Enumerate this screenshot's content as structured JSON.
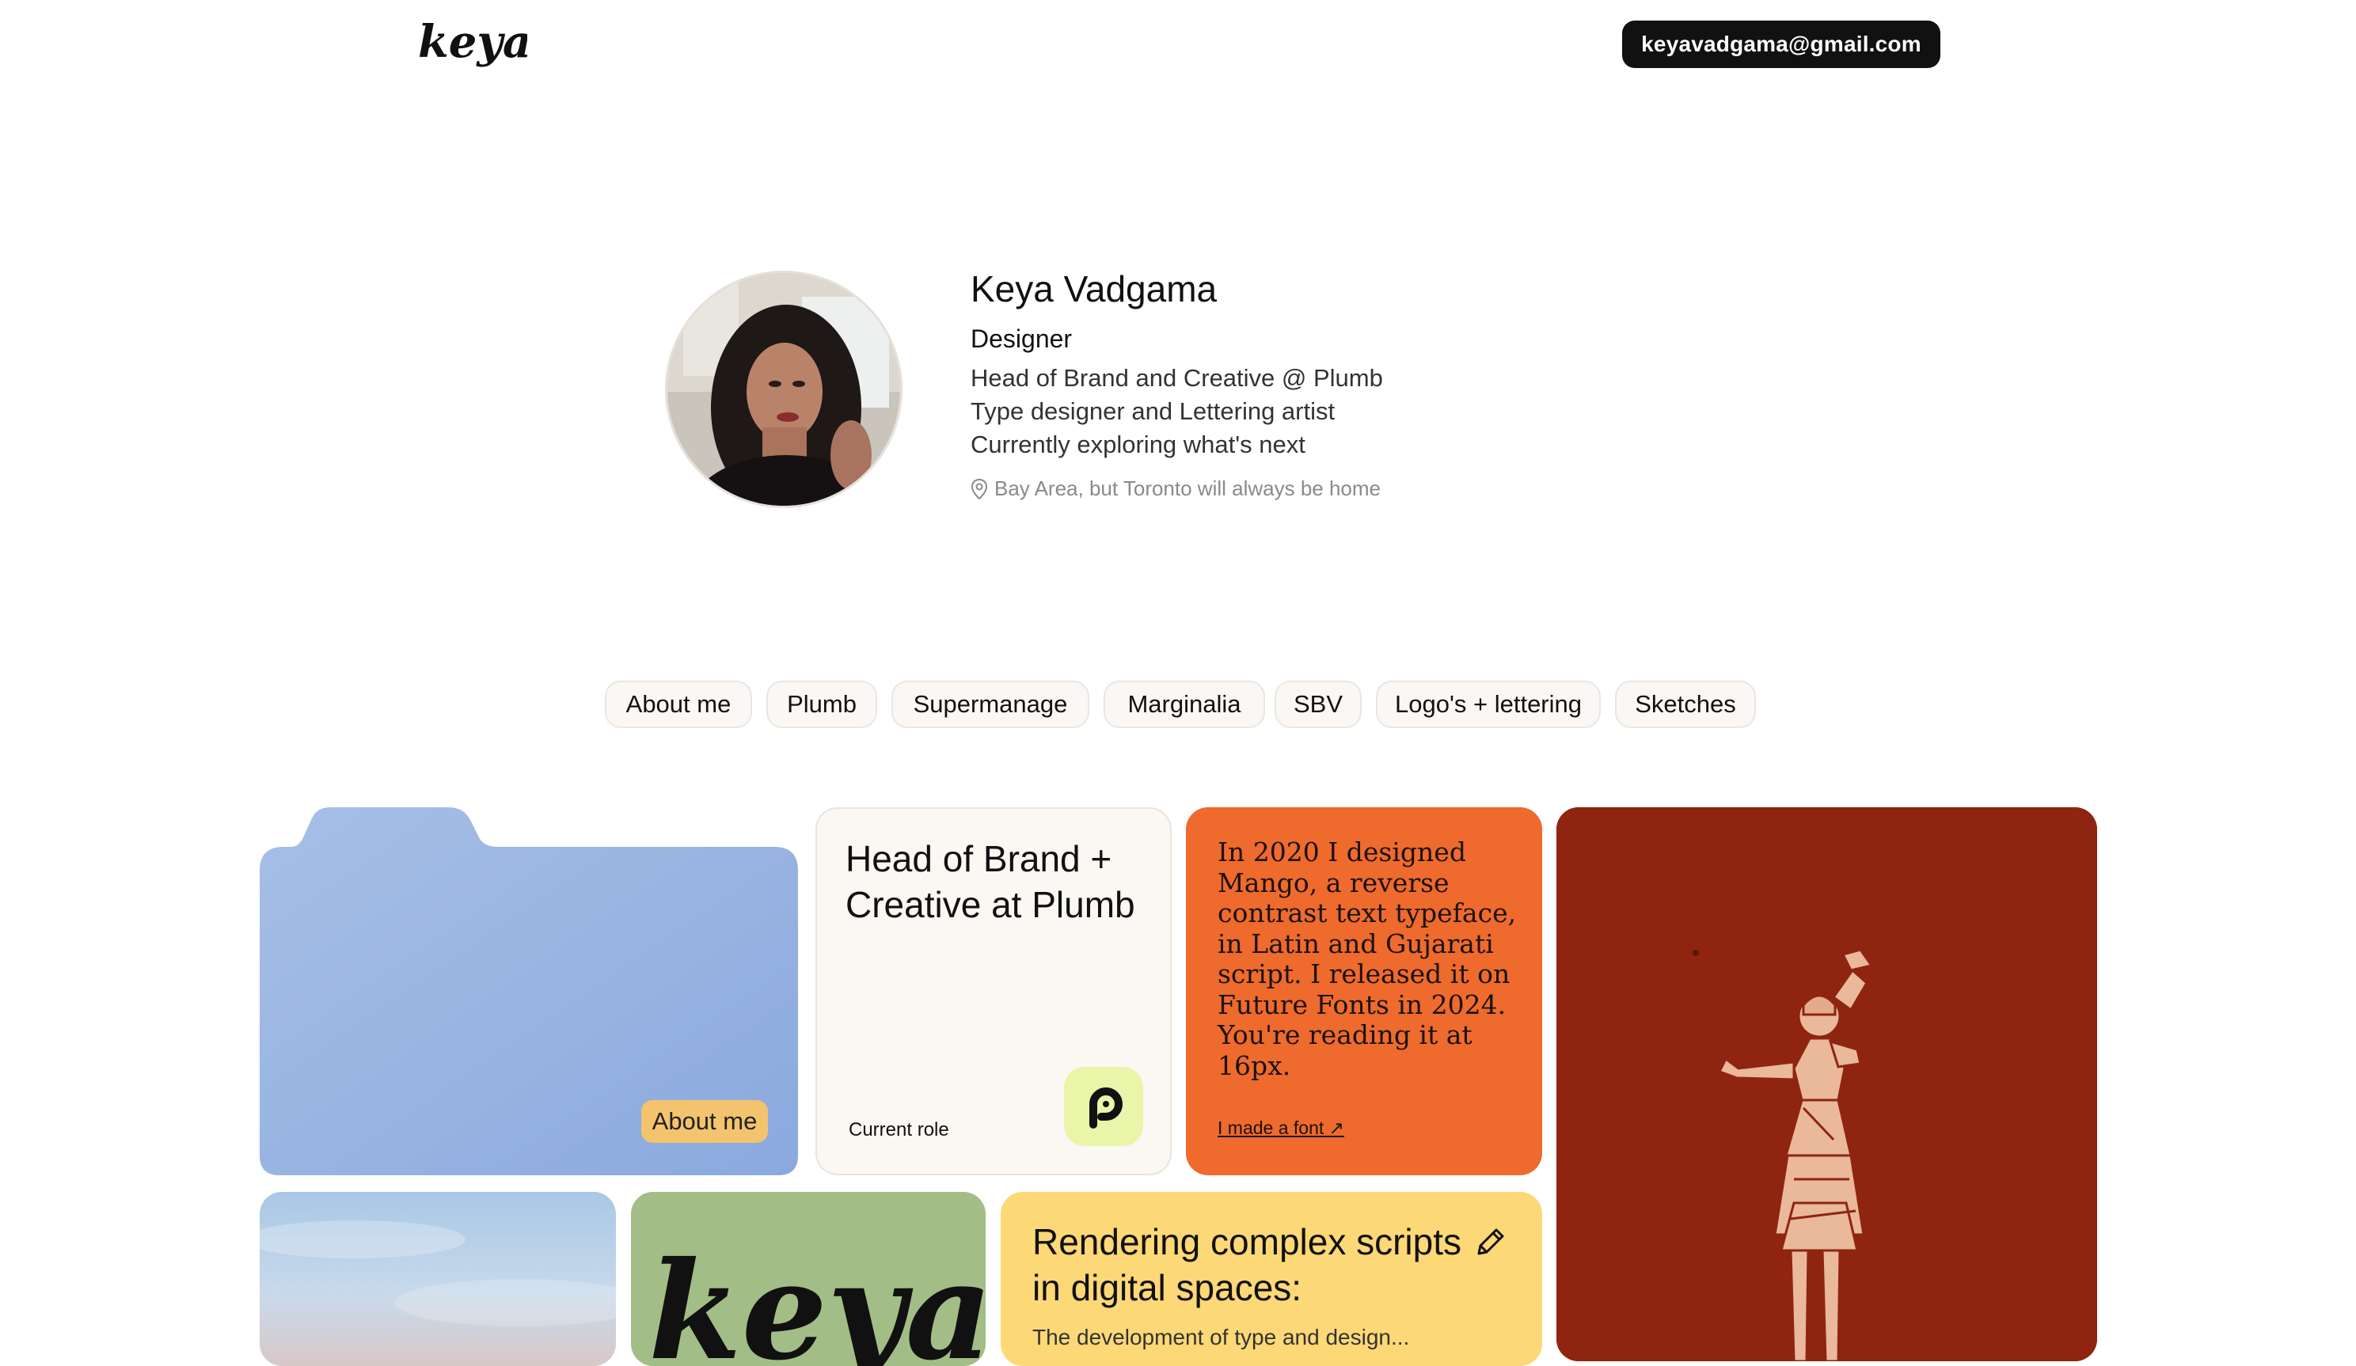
{
  "header": {
    "logo_text": "keya",
    "email": "keyavadgama@gmail.com"
  },
  "profile": {
    "name": "Keya Vadgama",
    "role": "Designer",
    "lines": [
      "Head of Brand and Creative @ Plumb",
      "Type designer and Lettering artist",
      "Currently exploring what's next"
    ],
    "location": "Bay Area, but Toronto will always be home"
  },
  "nav": {
    "pills": [
      "About me",
      "Plumb",
      "Supermanage",
      "Marginalia",
      "SBV",
      "Logo's + lettering",
      "Sketches"
    ]
  },
  "cards": {
    "folder": {
      "badge": "About me"
    },
    "role": {
      "title": "Head of Brand + Creative at Plumb",
      "label": "Current role"
    },
    "mango": {
      "text": "In 2020 I designed Mango, a reverse contrast text typeface, in Latin and Gujarati script. I released it on Future Fonts in 2024. You're reading it at 16px.",
      "link": "I made a font ↗"
    },
    "lettering": {
      "logo_text": "keya"
    },
    "writing": {
      "title": "Rendering complex scripts in digital spaces:",
      "excerpt": "The development of type and design..."
    }
  },
  "colors": {
    "folder_blue": "#98b6e3",
    "mango_orange": "#ee6a2d",
    "art_red": "#8f2511",
    "yellow": "#fdd877",
    "green": "#a3bd86",
    "badge_yellow": "#f3c46d"
  }
}
